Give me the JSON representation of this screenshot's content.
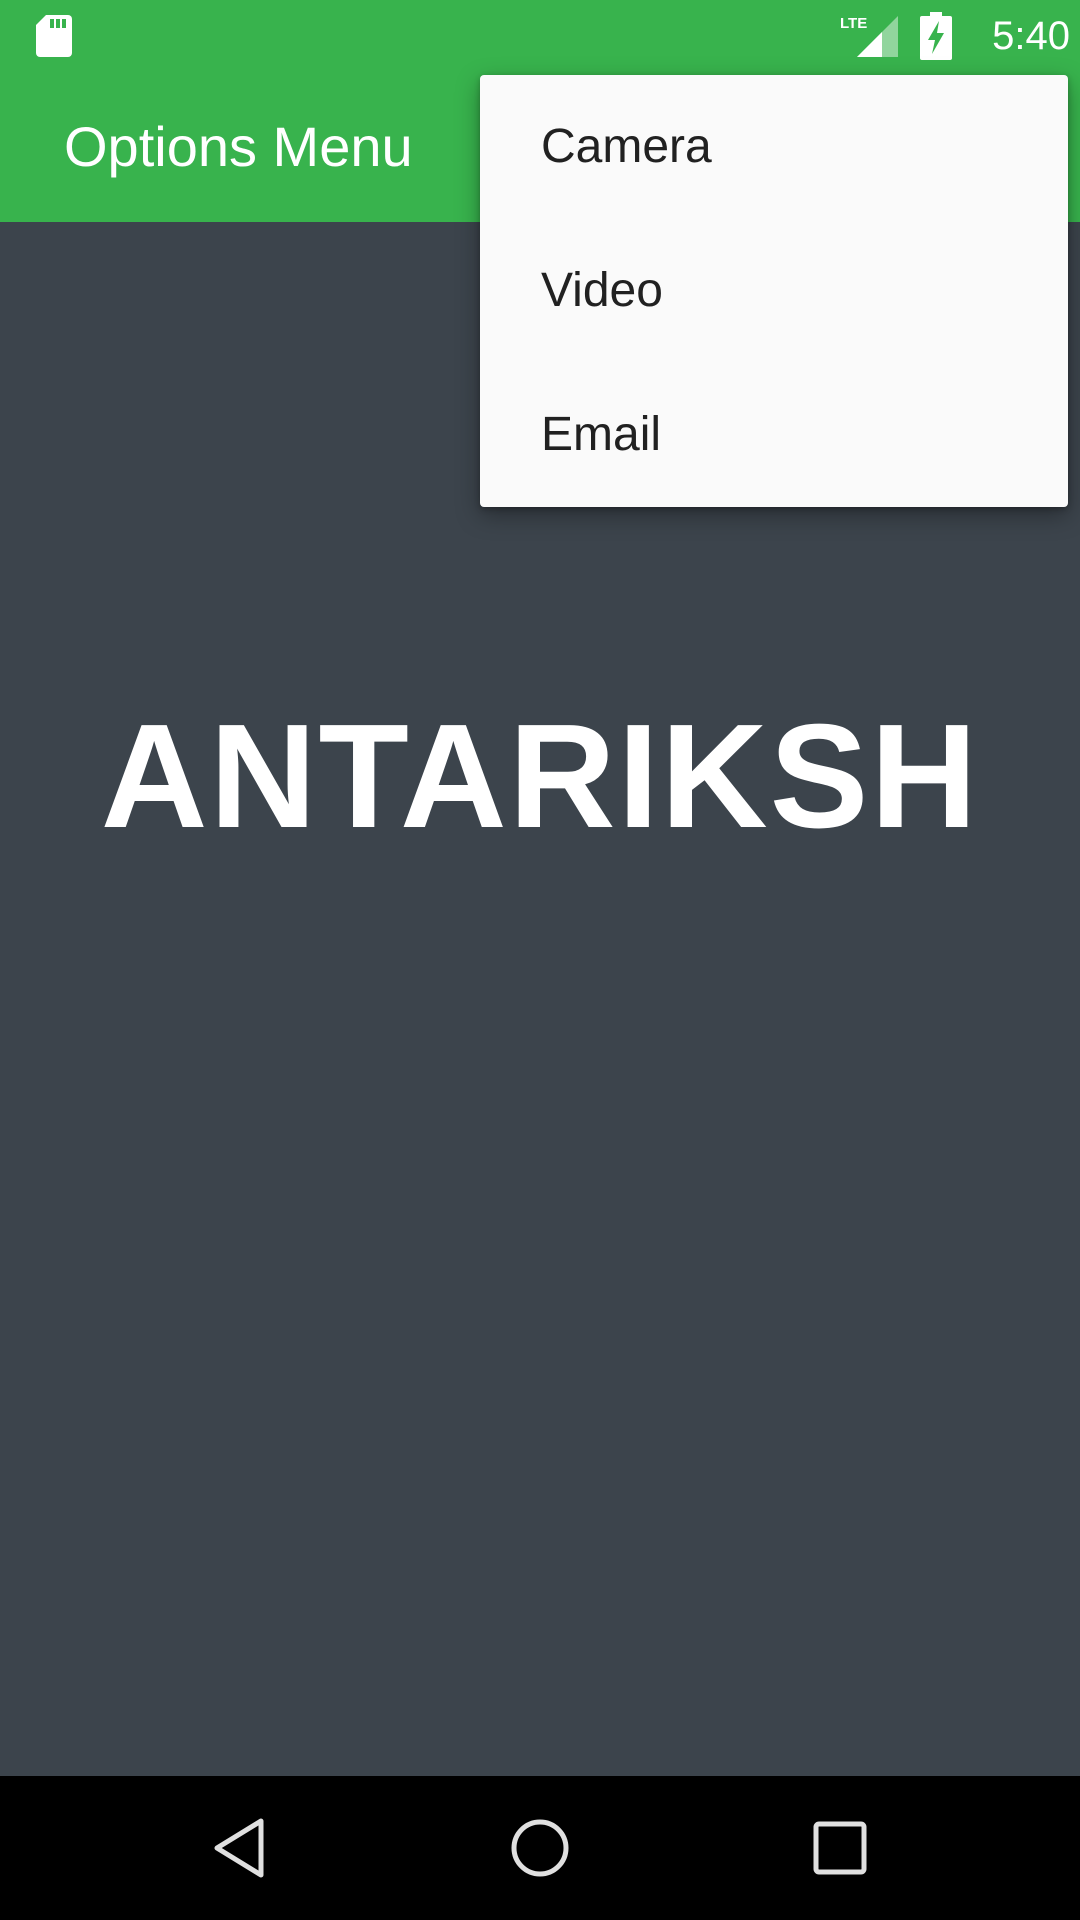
{
  "status_bar": {
    "time": "5:40",
    "network_label": "LTE",
    "icons": [
      "sd-card-icon",
      "lte-signal-icon",
      "battery-charging-icon"
    ]
  },
  "app_bar": {
    "title": "Options Menu",
    "color": "#38b34d"
  },
  "content": {
    "headline": "ANTARIKSH",
    "background": "#3c444c"
  },
  "options_menu": {
    "items": [
      {
        "label": "Camera"
      },
      {
        "label": "Video"
      },
      {
        "label": "Email"
      }
    ]
  },
  "nav_bar": {
    "buttons": [
      "back-icon",
      "home-icon",
      "recents-icon"
    ]
  }
}
